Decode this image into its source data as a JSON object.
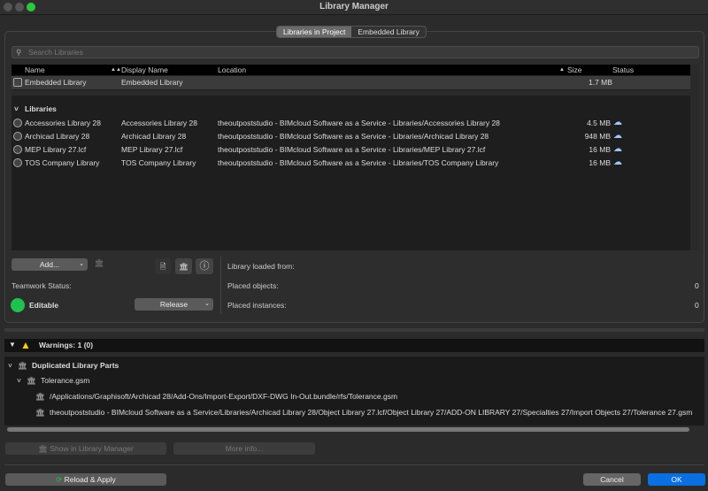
{
  "window": {
    "title": "Library Manager"
  },
  "tabs": [
    {
      "label": "Libraries in Project",
      "active": true
    },
    {
      "label": "Embedded Library",
      "active": false
    }
  ],
  "search": {
    "placeholder": "Search Libraries"
  },
  "columns": {
    "name": "Name",
    "display": "Display Name",
    "location": "Location",
    "size": "Size",
    "status": "Status"
  },
  "embedded": {
    "name": "Embedded Library",
    "display": "Embedded Library",
    "location": "",
    "size": "1.7 MB"
  },
  "group_label": "Libraries",
  "libraries": [
    {
      "name": "Accessories Library 28",
      "display": "Accessories Library 28",
      "location": "theoutpoststudio - BIMcloud Software as a Service - Libraries/Accessories Library 28",
      "size": "4.5 MB",
      "status": "cloud-icon"
    },
    {
      "name": "Archicad Library 28",
      "display": "Archicad Library 28",
      "location": "theoutpoststudio - BIMcloud Software as a Service - Libraries/Archicad Library 28",
      "size": "948 MB",
      "status": "cloud-icon"
    },
    {
      "name": "MEP Library 27.lcf",
      "display": "MEP Library 27.lcf",
      "location": "theoutpoststudio - BIMcloud Software as a Service - Libraries/MEP Library 27.lcf",
      "size": "16 MB",
      "status": "cloud-icon"
    },
    {
      "name": "TOS Company Library",
      "display": "TOS Company Library",
      "location": "theoutpoststudio - BIMcloud Software as a Service - Libraries/TOS Company Library",
      "size": "16 MB",
      "status": "cloud-icon"
    }
  ],
  "controls": {
    "add": "Add...",
    "teamwork_label": "Teamwork Status:",
    "teamwork_status": "Editable",
    "release": "Release",
    "status_color": "#1fc24f"
  },
  "info": {
    "loaded_from": "Library loaded from:",
    "placed_objects": "Placed objects:",
    "placed_objects_value": "0",
    "placed_instances": "Placed instances:",
    "placed_instances_value": "0"
  },
  "warnings": {
    "title": "Warnings: 1 (0)",
    "group": "Duplicated Library Parts",
    "item": "Tolerance.gsm",
    "paths": [
      "/Applications/Graphisoft/Archicad 28/Add-Ons/Import-Export/DXF-DWG In-Out.bundle/rfs/Tolerance.gsm",
      "theoutpoststudio - BIMcloud Software as a Service/Libraries/Archicad Library 28/Object Library 27.lcf/Object Library 27/ADD-ON LIBRARY 27/Specialties 27/Import Objects 27/Tolerance 27.gsm"
    ]
  },
  "buttons": {
    "show": "Show in Library Manager",
    "more": "More info...",
    "reload": "Reload & Apply",
    "cancel": "Cancel",
    "ok": "OK"
  },
  "colors": {
    "accent": "#0a6fe0",
    "warning": "#f5cc1a"
  }
}
